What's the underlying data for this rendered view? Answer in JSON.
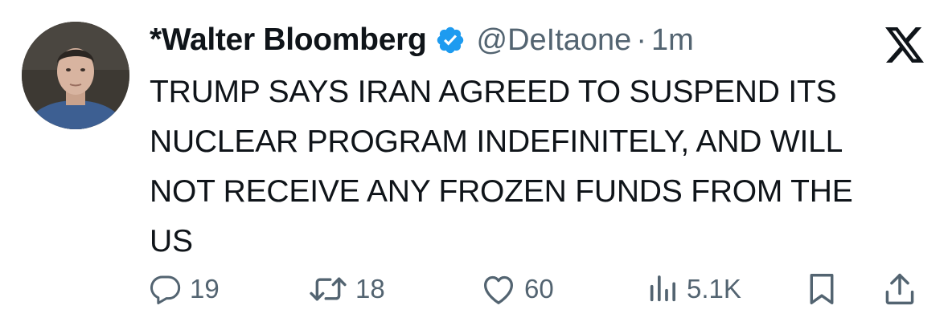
{
  "tweet": {
    "author_name": "*Walter Bloomberg",
    "handle": "@DeItaone",
    "separator": "·",
    "timestamp": "1m",
    "text": "TRUMP SAYS IRAN AGREED TO SUSPEND ITS\nNUCLEAR PROGRAM INDEFINITELY, AND WILL\nNOT RECEIVE ANY FROZEN FUNDS FROM THE\nUS",
    "verified_badge_color": "#1d9bf0"
  },
  "actions": {
    "replies": "19",
    "reposts": "18",
    "likes": "60",
    "views": "5.1K"
  },
  "icons": [
    "reply-icon",
    "repost-icon",
    "like-icon",
    "views-icon",
    "bookmark-icon",
    "share-icon",
    "x-logo-icon",
    "verified-badge-icon"
  ],
  "colors": {
    "text": "#0f1419",
    "secondary": "#536471",
    "accent": "#1d9bf0"
  }
}
